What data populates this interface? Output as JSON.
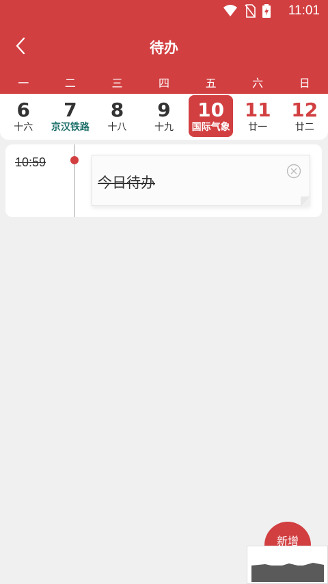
{
  "status_bar": {
    "time": "11:01"
  },
  "header": {
    "title": "待办"
  },
  "weekdays": [
    "一",
    "二",
    "三",
    "四",
    "五",
    "六",
    "日"
  ],
  "days": [
    {
      "num": "6",
      "sub": "十六"
    },
    {
      "num": "7",
      "sub": "京汉铁路"
    },
    {
      "num": "8",
      "sub": "十八"
    },
    {
      "num": "9",
      "sub": "十九"
    },
    {
      "num": "10",
      "sub": "国际气象"
    },
    {
      "num": "11",
      "sub": "廿一"
    },
    {
      "num": "12",
      "sub": "廿二"
    }
  ],
  "todo": {
    "time": "10:59",
    "text": "今日待办"
  },
  "fab": {
    "label": "新增"
  },
  "colors": {
    "accent": "#d23f41",
    "festival": "#1d6f6a",
    "background": "#f0f0f0"
  }
}
